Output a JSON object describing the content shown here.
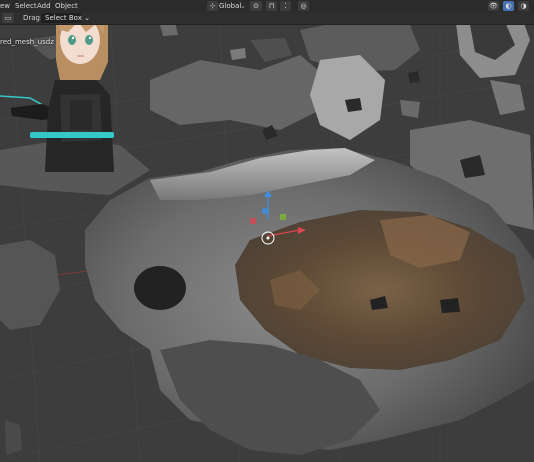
{
  "menubar": {
    "view_label": "ew",
    "items": [
      "Select",
      "Add",
      "Object"
    ],
    "orientation_label": "Global",
    "orientation_icon": "transform-orientation-icon",
    "snap_icon": "snap-magnet-icon",
    "proportional_icon": "proportional-editing-icon"
  },
  "toolbar": {
    "mode_icon": "mode-select-icon",
    "drag_label": "Drag:",
    "drag_value": "Select Box",
    "drag_chevron": "⌄"
  },
  "viewport": {
    "object_name": "red_mesh_usdz",
    "gizmo": {
      "x_color": "#d9484f",
      "y_color": "#7eb533",
      "z_color": "#3f8ee0"
    },
    "header_icons": [
      "visibility-icon",
      "viewport-shading-icon",
      "xray-icon"
    ]
  },
  "overlay": {
    "character": "vtuber-avatar",
    "hair_color": "#b98f62",
    "eye_color": "#4f9a86",
    "accent_color": "#35c8c8"
  }
}
